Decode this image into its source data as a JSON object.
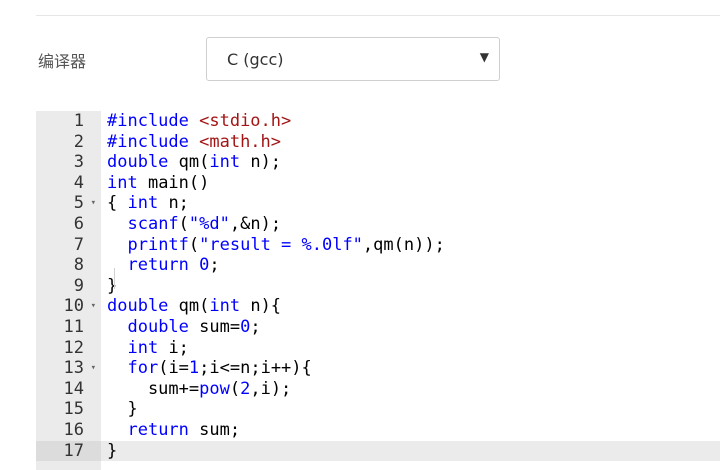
{
  "compiler": {
    "label": "编译器",
    "selected": "C (gcc)",
    "arrow_icon": "triangle-down"
  },
  "editor": {
    "active_line": 17,
    "lines": [
      {
        "n": "1",
        "fold": "",
        "tokens": [
          {
            "t": "#include ",
            "c": "kw"
          },
          {
            "t": "<stdio.h>",
            "c": "str"
          }
        ]
      },
      {
        "n": "2",
        "fold": "",
        "tokens": [
          {
            "t": "#include ",
            "c": "kw"
          },
          {
            "t": "<math.h>",
            "c": "str"
          }
        ]
      },
      {
        "n": "3",
        "fold": "",
        "tokens": [
          {
            "t": "double",
            "c": "kw"
          },
          {
            "t": " qm(",
            "c": "plain"
          },
          {
            "t": "int",
            "c": "kw"
          },
          {
            "t": " n);",
            "c": "plain"
          }
        ]
      },
      {
        "n": "4",
        "fold": "",
        "tokens": [
          {
            "t": "int",
            "c": "kw"
          },
          {
            "t": " main()",
            "c": "plain"
          }
        ]
      },
      {
        "n": "5",
        "fold": "▾",
        "tokens": [
          {
            "t": "{ ",
            "c": "plain"
          },
          {
            "t": "int",
            "c": "kw"
          },
          {
            "t": " n;",
            "c": "plain"
          }
        ]
      },
      {
        "n": "6",
        "fold": "",
        "tokens": [
          {
            "t": "  ",
            "c": "plain"
          },
          {
            "t": "scanf",
            "c": "kw"
          },
          {
            "t": "(",
            "c": "plain"
          },
          {
            "t": "\"%d\"",
            "c": "kw"
          },
          {
            "t": ",&n);",
            "c": "plain"
          }
        ]
      },
      {
        "n": "7",
        "fold": "",
        "tokens": [
          {
            "t": "  ",
            "c": "plain"
          },
          {
            "t": "printf",
            "c": "kw"
          },
          {
            "t": "(",
            "c": "plain"
          },
          {
            "t": "\"result = %.0lf\"",
            "c": "kw"
          },
          {
            "t": ",qm(n));",
            "c": "plain"
          }
        ]
      },
      {
        "n": "8",
        "fold": "",
        "tokens": [
          {
            "t": "  ",
            "c": "plain"
          },
          {
            "t": "return",
            "c": "kw"
          },
          {
            "t": " ",
            "c": "plain"
          },
          {
            "t": "0",
            "c": "kw"
          },
          {
            "t": ";",
            "c": "plain"
          }
        ]
      },
      {
        "n": "9",
        "fold": "",
        "tokens": [
          {
            "t": "}",
            "c": "plain"
          }
        ]
      },
      {
        "n": "10",
        "fold": "▾",
        "tokens": [
          {
            "t": "double",
            "c": "kw"
          },
          {
            "t": " qm(",
            "c": "plain"
          },
          {
            "t": "int",
            "c": "kw"
          },
          {
            "t": " n){",
            "c": "plain"
          }
        ]
      },
      {
        "n": "11",
        "fold": "",
        "tokens": [
          {
            "t": "  ",
            "c": "plain"
          },
          {
            "t": "double",
            "c": "kw"
          },
          {
            "t": " sum=",
            "c": "plain"
          },
          {
            "t": "0",
            "c": "kw"
          },
          {
            "t": ";",
            "c": "plain"
          }
        ]
      },
      {
        "n": "12",
        "fold": "",
        "tokens": [
          {
            "t": "  ",
            "c": "plain"
          },
          {
            "t": "int",
            "c": "kw"
          },
          {
            "t": " i;",
            "c": "plain"
          }
        ]
      },
      {
        "n": "13",
        "fold": "▾",
        "tokens": [
          {
            "t": "  ",
            "c": "plain"
          },
          {
            "t": "for",
            "c": "kw"
          },
          {
            "t": "(i=",
            "c": "plain"
          },
          {
            "t": "1",
            "c": "kw"
          },
          {
            "t": ";i<=n;i++){",
            "c": "plain"
          }
        ]
      },
      {
        "n": "14",
        "fold": "",
        "tokens": [
          {
            "t": "    sum+=",
            "c": "plain"
          },
          {
            "t": "pow",
            "c": "kw"
          },
          {
            "t": "(",
            "c": "plain"
          },
          {
            "t": "2",
            "c": "kw"
          },
          {
            "t": ",i);",
            "c": "plain"
          }
        ]
      },
      {
        "n": "15",
        "fold": "",
        "tokens": [
          {
            "t": "  }",
            "c": "plain"
          }
        ]
      },
      {
        "n": "16",
        "fold": "",
        "tokens": [
          {
            "t": "  ",
            "c": "plain"
          },
          {
            "t": "return",
            "c": "kw"
          },
          {
            "t": " sum;",
            "c": "plain"
          }
        ]
      },
      {
        "n": "17",
        "fold": "",
        "tokens": [
          {
            "t": "}",
            "c": "plain"
          }
        ]
      }
    ]
  }
}
